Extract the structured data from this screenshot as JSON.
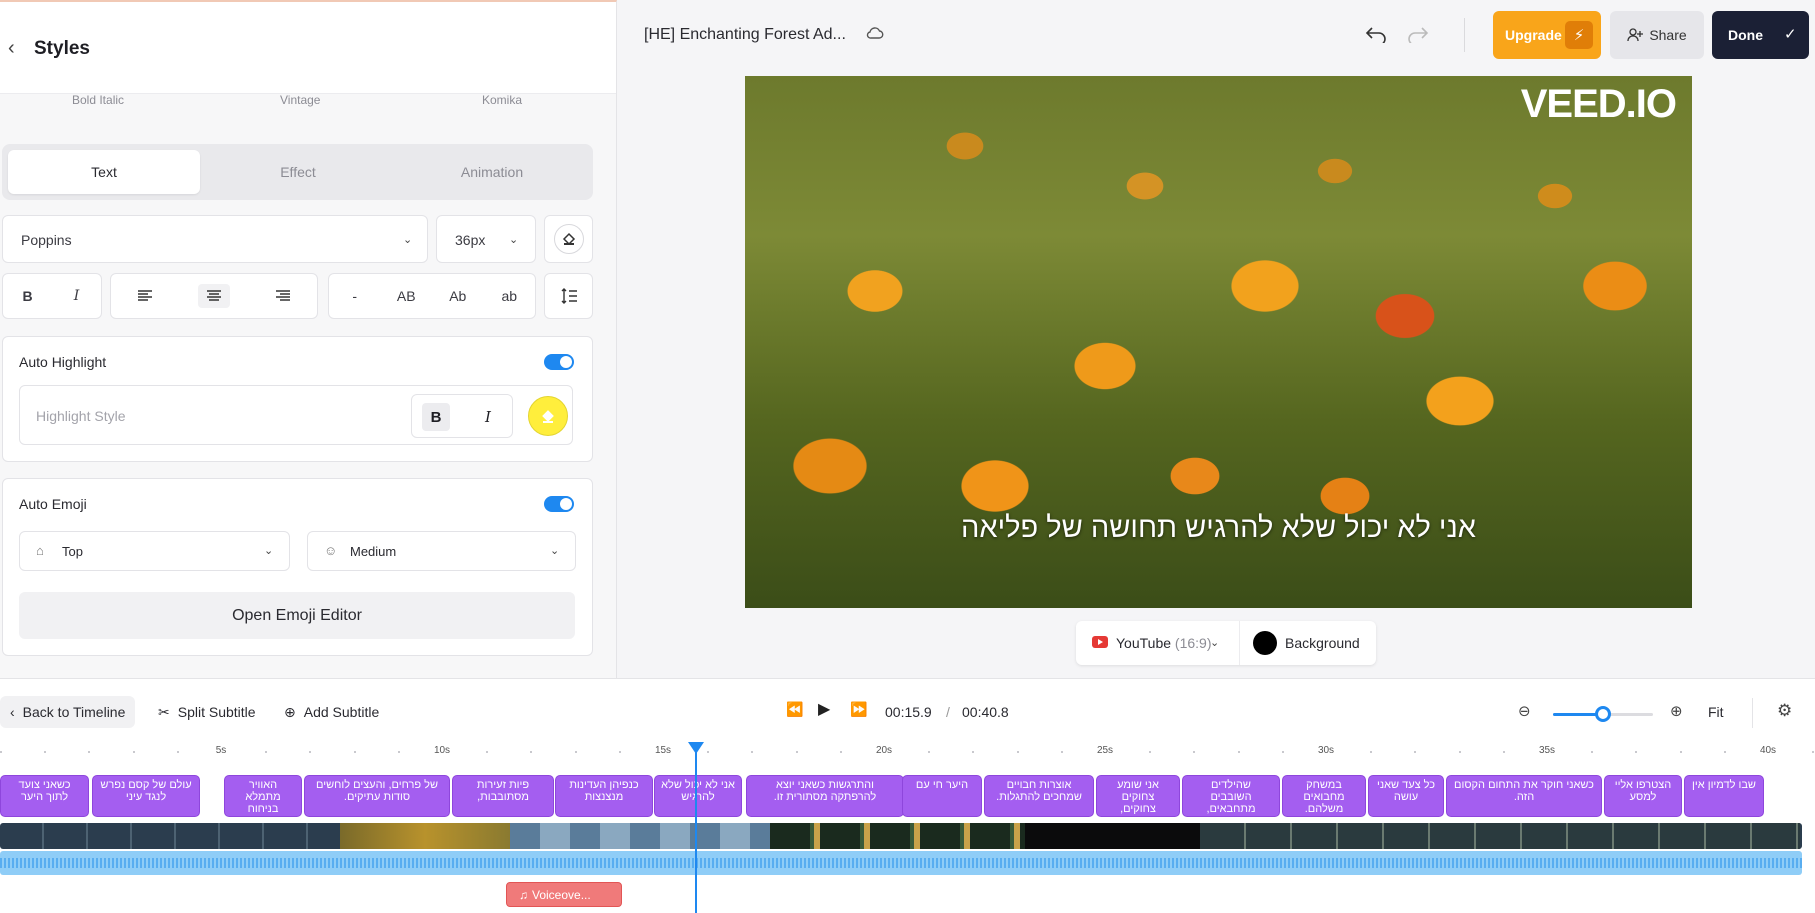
{
  "styles_panel": {
    "title": "Styles",
    "presets": [
      "Bold Italic",
      "Vintage",
      "Komika"
    ],
    "tabs": [
      "Text",
      "Effect",
      "Animation"
    ],
    "active_tab": "Text",
    "font_family": "Poppins",
    "font_size": "36px",
    "case_options": [
      "-",
      "AB",
      "Ab",
      "ab"
    ],
    "format": {
      "bold": "B",
      "italic": "I"
    },
    "auto_highlight": {
      "title": "Auto Highlight",
      "enabled": true,
      "placeholder": "Highlight Style",
      "bold": "B",
      "italic": "I",
      "color": "#ffee3c"
    },
    "auto_emoji": {
      "title": "Auto Emoji",
      "enabled": true,
      "position": "Top",
      "size": "Medium",
      "editor_button": "Open Emoji Editor"
    }
  },
  "topbar": {
    "project_title": "[HE] Enchanting Forest Ad...",
    "upgrade": "Upgrade",
    "share": "Share",
    "done": "Done"
  },
  "canvas": {
    "logo": "VEED.IO",
    "subtitle": "אני לא יכול שלא להרגיש תחושה של פליאה"
  },
  "aspect": {
    "platform": "YouTube",
    "ratio": "(16:9)",
    "background": "Background"
  },
  "timeline": {
    "back_to_timeline": "Back to Timeline",
    "split_subtitle": "Split Subtitle",
    "add_subtitle": "Add Subtitle",
    "current_time": "00:15.9",
    "time_sep": "/",
    "total_time": "00:40.8",
    "fit": "Fit",
    "zoom_level": 0.5,
    "ruler_labels": [
      "5s",
      "10s",
      "15s",
      "20s",
      "25s",
      "30s",
      "35s",
      "40s"
    ],
    "voiceover": "Voiceove...",
    "clips": [
      "כשאני צועד לתוך היער",
      "עולם של קסם נפרש לנגד עיני",
      "האוויר מתמלא בניחוח",
      "של פרחים, והעצים לוחשים סודות עתיקים.",
      "פיות זעירות מסתובבות,",
      "כנפיהן העדינות מנצנצות",
      "אני לא יכול שלא להרגיש",
      "והתרגשות כשאני יוצא להרפתקה מסתורית זו.",
      "היער חי עם",
      "אוצרות חבויים שמחכים להתגלות.",
      "אני שומע צחוקים צחוקים,",
      "שהילדים השובבים מתחבאים,",
      "במשחק מחבואים משלהם.",
      "כל צעד שאני עושה",
      "כשאני חוקר את התחום הקסום הזה.",
      "הצטרפו אליי למסע",
      "שבו לדמיון אין"
    ]
  }
}
